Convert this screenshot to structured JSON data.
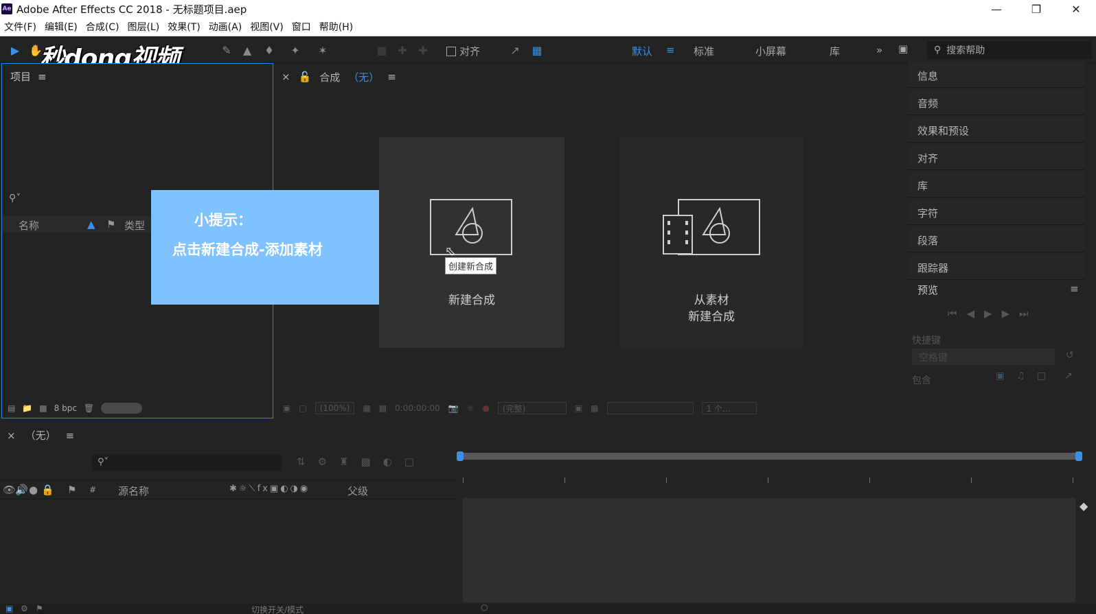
{
  "window": {
    "title": "Adobe After Effects CC 2018 - 无标题项目.aep",
    "app_icon": "Ae",
    "controls": [
      "minimize-icon",
      "restore-icon",
      "close-icon"
    ]
  },
  "menu": [
    "文件(F)",
    "编辑(E)",
    "合成(C)",
    "图层(L)",
    "效果(T)",
    "动画(A)",
    "视图(V)",
    "窗口",
    "帮助(H)"
  ],
  "toolbar": {
    "align_label": "对齐",
    "workspaces": [
      "默认",
      "标准",
      "小屏幕",
      "库"
    ],
    "active_workspace": "默认",
    "search_placeholder": "搜索帮助"
  },
  "watermark": "秒dong视频",
  "project": {
    "title": "项目",
    "col_name": "名称",
    "col_type": "类型",
    "bpc": "8 bpc"
  },
  "tip": {
    "title": "小提示：",
    "body": "点击新建合成-添加素材"
  },
  "comp": {
    "title": "合成",
    "none": "（无）",
    "new_comp": "新建合成",
    "tooltip": "创建新合成",
    "from_footage_line1": "从素材",
    "from_footage_line2": "新建合成",
    "footer_zoom": "(100%)",
    "footer_time": "0:00:00:00",
    "footer_res": "(完整)",
    "footer_views": "1 个..."
  },
  "right_panels": [
    "信息",
    "音频",
    "效果和预设",
    "对齐",
    "库",
    "字符",
    "段落",
    "跟踪器"
  ],
  "preview": {
    "title": "预览",
    "shortcut_label": "快捷键",
    "shortcut_value": "空格键",
    "include_label": "包含"
  },
  "timeline": {
    "title": "（无）",
    "col_source": "源名称",
    "col_parent": "父级",
    "col_hash": "#",
    "toggle_label": "切换开关/模式"
  },
  "colors": {
    "accent": "#3d8ee6",
    "tip_bg": "#7ec2ff",
    "panel_bg": "#232323"
  }
}
